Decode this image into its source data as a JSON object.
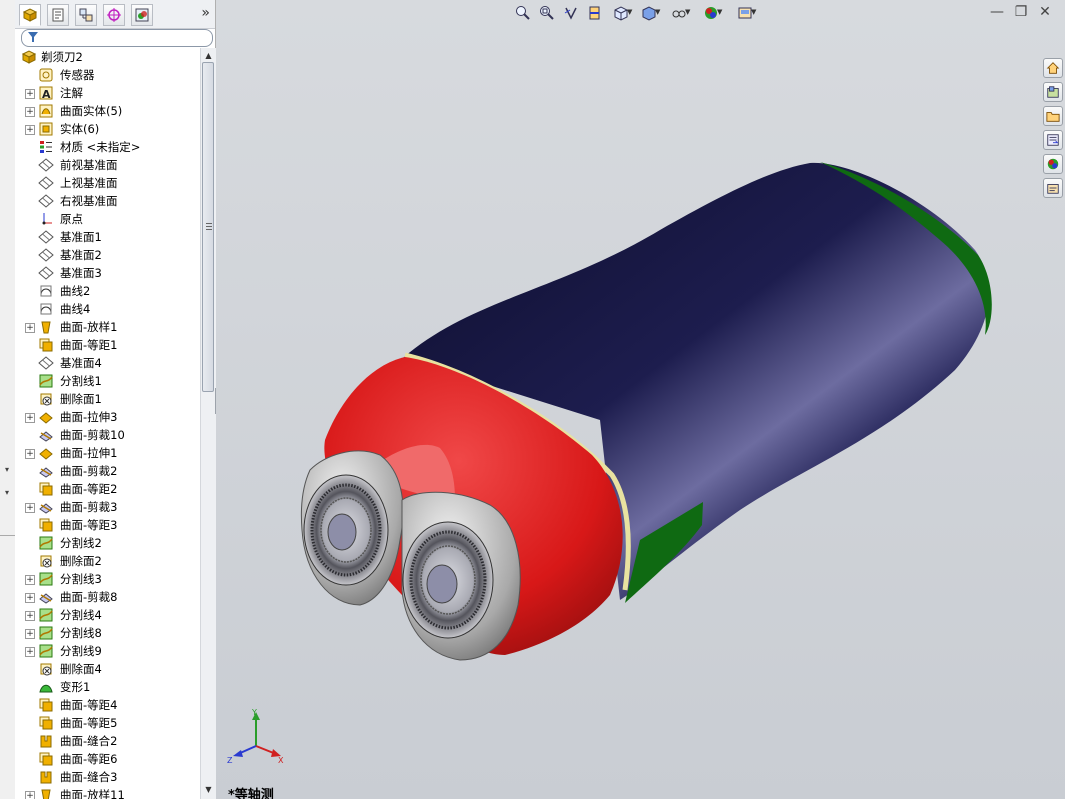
{
  "feature_tree": {
    "root": "剃须刀2",
    "items": [
      {
        "label": "传感器",
        "icon": "sensor-icon",
        "expandable": false
      },
      {
        "label": "注解",
        "icon": "annotation-icon",
        "expandable": true
      },
      {
        "label": "曲面实体(5)",
        "icon": "surface-bodies-icon",
        "expandable": true
      },
      {
        "label": "实体(6)",
        "icon": "solid-bodies-icon",
        "expandable": true
      },
      {
        "label": "材质 <未指定>",
        "icon": "material-icon",
        "expandable": false
      },
      {
        "label": "前视基准面",
        "icon": "plane-icon",
        "expandable": false
      },
      {
        "label": "上视基准面",
        "icon": "plane-icon",
        "expandable": false
      },
      {
        "label": "右视基准面",
        "icon": "plane-icon",
        "expandable": false
      },
      {
        "label": "原点",
        "icon": "origin-icon",
        "expandable": false
      },
      {
        "label": "基准面1",
        "icon": "plane-icon",
        "expandable": false
      },
      {
        "label": "基准面2",
        "icon": "plane-icon",
        "expandable": false
      },
      {
        "label": "基准面3",
        "icon": "plane-icon",
        "expandable": false
      },
      {
        "label": "曲线2",
        "icon": "curve-icon",
        "expandable": false
      },
      {
        "label": "曲线4",
        "icon": "curve-icon",
        "expandable": false
      },
      {
        "label": "曲面-放样1",
        "icon": "surface-loft-icon",
        "expandable": true
      },
      {
        "label": "曲面-等距1",
        "icon": "surface-offset-icon",
        "expandable": false
      },
      {
        "label": "基准面4",
        "icon": "plane-icon",
        "expandable": false
      },
      {
        "label": "分割线1",
        "icon": "split-line-icon",
        "expandable": false
      },
      {
        "label": "删除面1",
        "icon": "delete-face-icon",
        "expandable": false
      },
      {
        "label": "曲面-拉伸3",
        "icon": "surface-extrude-icon",
        "expandable": true
      },
      {
        "label": "曲面-剪裁10",
        "icon": "surface-trim-icon",
        "expandable": false
      },
      {
        "label": "曲面-拉伸1",
        "icon": "surface-extrude-icon",
        "expandable": true
      },
      {
        "label": "曲面-剪裁2",
        "icon": "surface-trim-icon",
        "expandable": false
      },
      {
        "label": "曲面-等距2",
        "icon": "surface-offset-icon",
        "expandable": false
      },
      {
        "label": "曲面-剪裁3",
        "icon": "surface-trim-icon",
        "expandable": true
      },
      {
        "label": "曲面-等距3",
        "icon": "surface-offset-icon",
        "expandable": false
      },
      {
        "label": "分割线2",
        "icon": "split-line-icon",
        "expandable": false
      },
      {
        "label": "删除面2",
        "icon": "delete-face-icon",
        "expandable": false
      },
      {
        "label": "分割线3",
        "icon": "split-line-icon",
        "expandable": true
      },
      {
        "label": "曲面-剪裁8",
        "icon": "surface-trim-icon",
        "expandable": true
      },
      {
        "label": "分割线4",
        "icon": "split-line-icon",
        "expandable": true
      },
      {
        "label": "分割线8",
        "icon": "split-line-icon",
        "expandable": true
      },
      {
        "label": "分割线9",
        "icon": "split-line-icon",
        "expandable": true
      },
      {
        "label": "删除面4",
        "icon": "delete-face-icon",
        "expandable": false
      },
      {
        "label": "变形1",
        "icon": "deform-icon",
        "expandable": false
      },
      {
        "label": "曲面-等距4",
        "icon": "surface-offset-icon",
        "expandable": false
      },
      {
        "label": "曲面-等距5",
        "icon": "surface-offset-icon",
        "expandable": false
      },
      {
        "label": "曲面-缝合2",
        "icon": "surface-knit-icon",
        "expandable": false
      },
      {
        "label": "曲面-等距6",
        "icon": "surface-offset-icon",
        "expandable": false
      },
      {
        "label": "曲面-缝合3",
        "icon": "surface-knit-icon",
        "expandable": false
      },
      {
        "label": "曲面-放样11",
        "icon": "surface-loft-icon",
        "expandable": true
      }
    ]
  },
  "panel_tabs": [
    "feature-manager-tab-icon",
    "property-manager-tab-icon",
    "configuration-manager-tab-icon",
    "dimxpert-tab-icon",
    "display-manager-tab-icon"
  ],
  "panel_more": "»",
  "viewport": {
    "view_name": "*等轴测",
    "toolbar_icons": [
      "zoom-to-fit-icon",
      "zoom-to-area-icon",
      "previous-view-icon",
      "section-view-icon",
      "view-orientation-icon",
      "display-style-icon",
      "hide-show-items-icon",
      "edit-appearance-icon",
      "apply-scene-icon"
    ],
    "window_controls": {
      "minimize": "—",
      "restore": "❐",
      "close": "✕"
    },
    "task_pane_icons": [
      "home-icon",
      "design-library-icon",
      "file-explorer-icon",
      "view-palette-icon",
      "appearances-icon",
      "custom-properties-icon"
    ],
    "triad_labels": {
      "x": "X",
      "y": "Y",
      "z": "Z"
    }
  },
  "colors": {
    "body_navy": "#16163f",
    "head_red": "#d81818",
    "trim_yellow": "#e8e2a0",
    "accent_green": "#0f6a12",
    "viewport_bg": "#cfd2d7"
  }
}
